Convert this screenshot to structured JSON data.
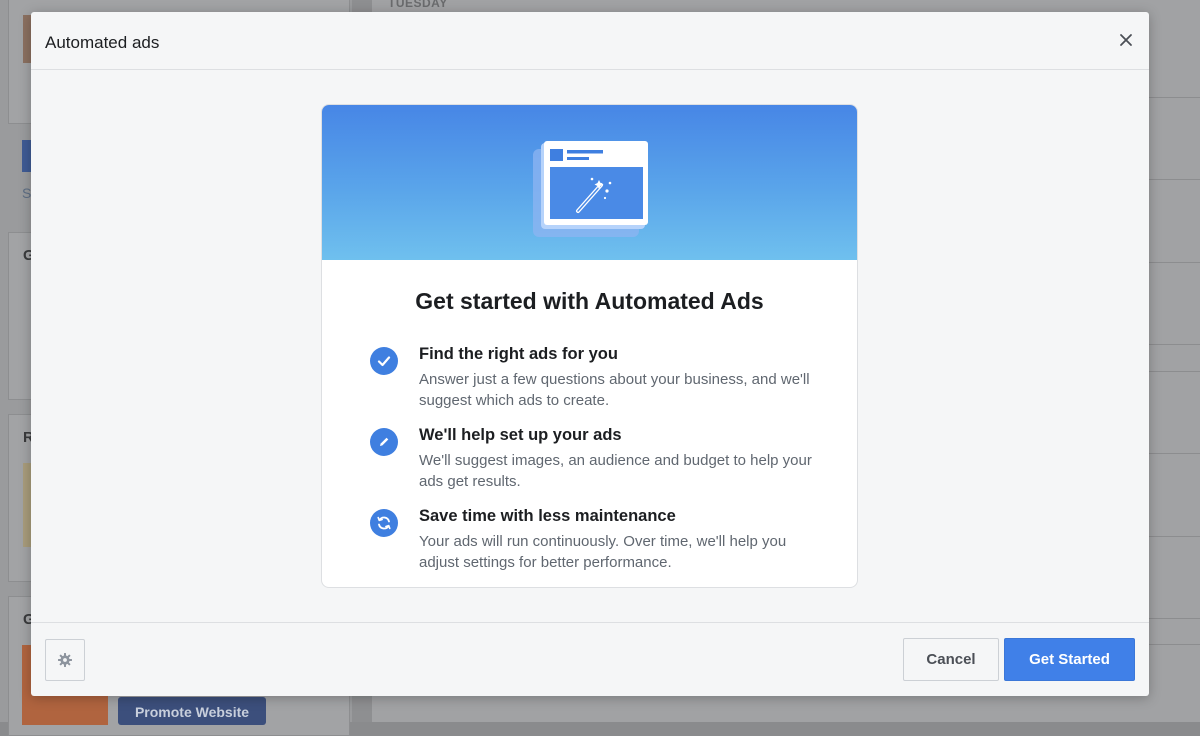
{
  "background": {
    "day_label": "TUESDAY",
    "promote_button": "Promote Website",
    "card_headings": [
      "G",
      "R",
      "G"
    ],
    "s_letter": "S"
  },
  "modal": {
    "title": "Automated ads",
    "card": {
      "heading": "Get started with Automated Ads",
      "features": [
        {
          "icon": "checkmark-icon",
          "title": "Find the right ads for you",
          "description": "Answer just a few questions about your business, and we'll suggest which ads to create."
        },
        {
          "icon": "pencil-icon",
          "title": "We'll help set up your ads",
          "description": "We'll suggest images, an audience and budget to help your ads get results."
        },
        {
          "icon": "refresh-icon",
          "title": "Save time with less maintenance",
          "description": "Your ads will run continuously. Over time, we'll help you adjust settings for better performance."
        }
      ]
    },
    "footer": {
      "cancel_label": "Cancel",
      "start_label": "Get Started"
    }
  },
  "colors": {
    "primary": "#4080e8",
    "icon_blue": "#3f7fe0",
    "hero_top": "#4786e6",
    "hero_bottom": "#6fc0ee"
  }
}
